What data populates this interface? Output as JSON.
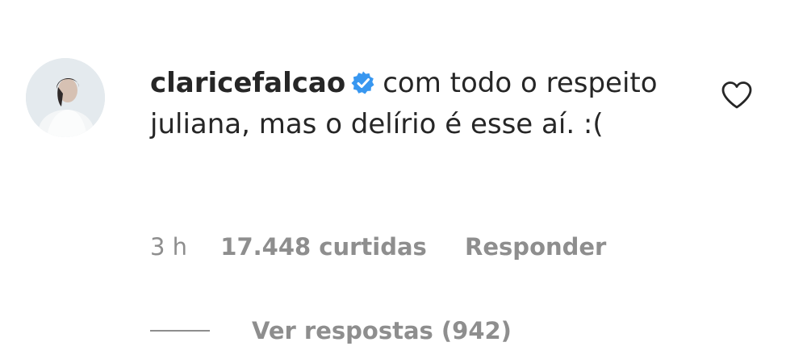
{
  "comment": {
    "username": "claricefalcao",
    "verified_icon": "verified-badge-icon",
    "text": "com todo o respeito juliana, mas o delírio é esse aí. :(",
    "like_icon": "heart-outline-icon"
  },
  "meta": {
    "time": "3 h",
    "likes": "17.448 curtidas",
    "reply_label": "Responder"
  },
  "replies": {
    "label": "Ver respostas (942)"
  },
  "colors": {
    "text": "#262626",
    "secondary": "#8e8e8e",
    "verified": "#3897f0"
  }
}
